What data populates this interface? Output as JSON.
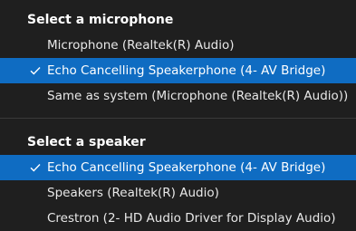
{
  "microphone_section": {
    "header": "Select a microphone",
    "items": [
      {
        "label": "Microphone (Realtek(R) Audio)",
        "selected": false
      },
      {
        "label": "Echo Cancelling Speakerphone (4- AV Bridge)",
        "selected": true
      },
      {
        "label": "Same as system (Microphone (Realtek(R) Audio))",
        "selected": false
      }
    ]
  },
  "speaker_section": {
    "header": "Select a speaker",
    "items": [
      {
        "label": "Echo Cancelling Speakerphone (4- AV Bridge)",
        "selected": true
      },
      {
        "label": "Speakers (Realtek(R) Audio)",
        "selected": false
      },
      {
        "label": "Crestron (2- HD Audio Driver for Display Audio)",
        "selected": false
      }
    ]
  },
  "icons": {
    "selected_check": "checkmark-icon"
  },
  "colors": {
    "background": "#1f1f1f",
    "selected_background": "#0f6cc2",
    "text": "#ffffff"
  }
}
